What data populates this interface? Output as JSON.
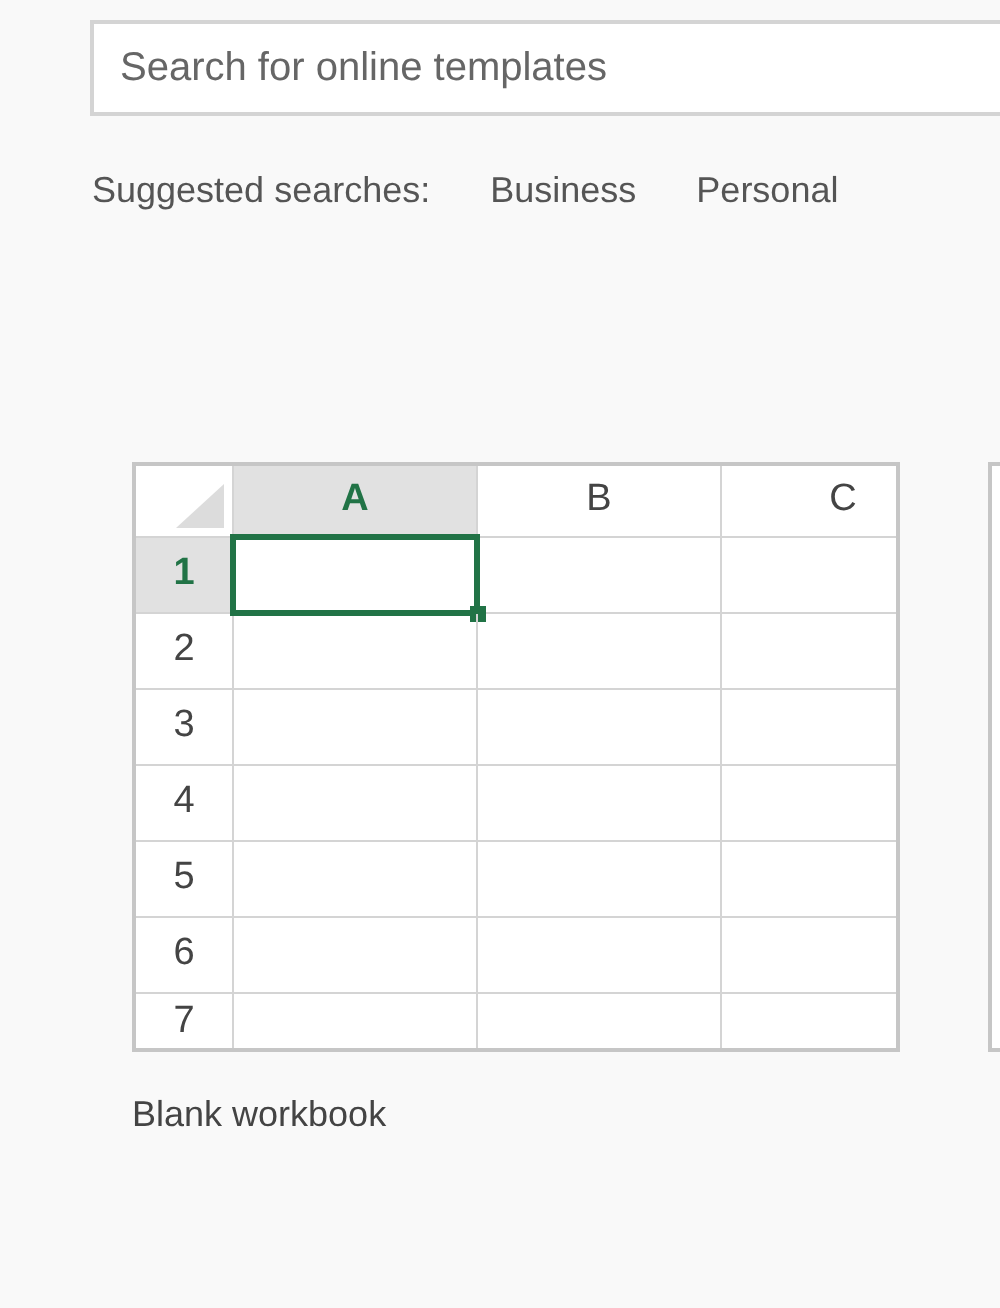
{
  "search": {
    "placeholder": "Search for online templates"
  },
  "suggested": {
    "label": "Suggested searches:",
    "items": [
      "Business",
      "Personal"
    ]
  },
  "templates": [
    {
      "name": "Blank workbook",
      "columns": [
        {
          "label": "A",
          "selected": true
        },
        {
          "label": "B",
          "selected": false
        },
        {
          "label": "C",
          "selected": false
        }
      ],
      "rows": [
        {
          "label": "1",
          "selected": true
        },
        {
          "label": "2",
          "selected": false
        },
        {
          "label": "3",
          "selected": false
        },
        {
          "label": "4",
          "selected": false
        },
        {
          "label": "5",
          "selected": false
        },
        {
          "label": "6",
          "selected": false
        },
        {
          "label": "7",
          "selected": false
        }
      ]
    }
  ]
}
